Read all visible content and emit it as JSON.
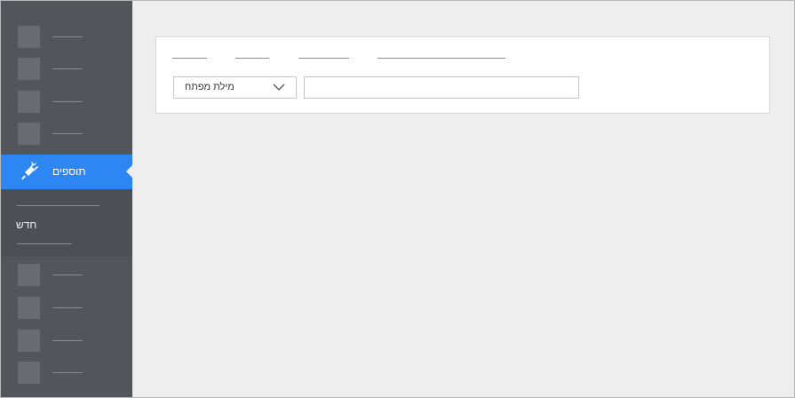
{
  "sidebar": {
    "active_item": {
      "label": "תוספים",
      "icon": "plug-icon"
    },
    "new_section": {
      "label": "חדש"
    }
  },
  "filter": {
    "select_value": "מילת מפתח",
    "select_icon": "chevron-down-icon",
    "search_value": ""
  },
  "colors": {
    "sidebar_bg": "#52565a",
    "accent": "#2e86f2",
    "page_bg": "#eeeeee"
  }
}
